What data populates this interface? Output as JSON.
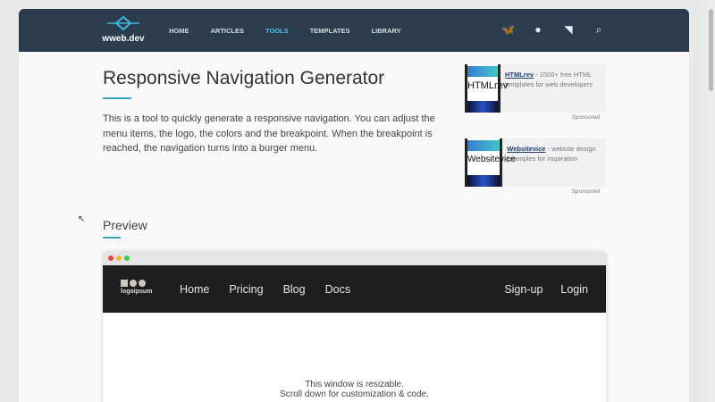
{
  "site": {
    "logo_text": "wweb.dev",
    "nav": [
      "HOME",
      "ARTICLES",
      "TOOLS",
      "TEMPLATES",
      "LIBRARY"
    ],
    "active": "TOOLS",
    "icons": [
      "bluesky-icon",
      "github-icon",
      "rss-icon",
      "search-icon"
    ]
  },
  "main": {
    "title": "Responsive Navigation Generator",
    "description": "This is a tool to quickly generate a responsive navigation. You can adjust the menu items, the logo, the colors and the breakpoint. When the breakpoint is reached, the navigation turns into a burger menu.",
    "preview_heading": "Preview"
  },
  "ads": [
    {
      "image_text": "HTMLrev",
      "link": "HTMLrev",
      "text": " - 1500+ free HTML templates for web developers",
      "sponsored": "Sponsored"
    },
    {
      "image_text": "Websitevice",
      "link": "Websitevice",
      "text": " - website design examples for inspiration",
      "sponsored": "Sponsored"
    }
  ],
  "preview": {
    "logo": "logoipsum",
    "links": [
      "Home",
      "Pricing",
      "Blog",
      "Docs"
    ],
    "right_links": [
      "Sign-up",
      "Login"
    ],
    "message_1": "This window is resizable.",
    "message_2": "Scroll down for customization & code."
  },
  "colors": {
    "header": "#2b3c4e",
    "accent": "#56c3e0",
    "demo_nav": "#1f1e1f"
  }
}
